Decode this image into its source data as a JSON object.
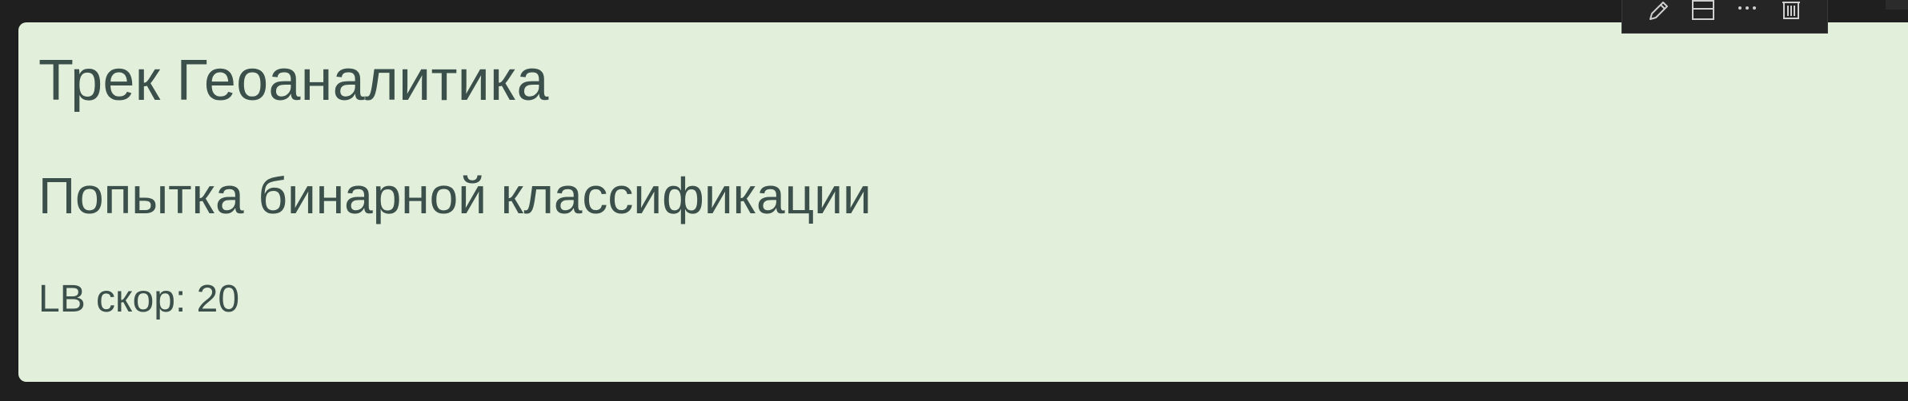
{
  "cell": {
    "heading1": "Трек Геоаналитика",
    "heading2": "Попытка бинарной классификации",
    "paragraph": "LB скор: 20"
  },
  "toolbar": {
    "icons": [
      "edit-icon",
      "split-cell-icon",
      "more-icon",
      "delete-icon"
    ]
  },
  "colors": {
    "page_background": "#1f1f1f",
    "cell_background": "#e2f0db",
    "text": "#3b4f4b",
    "toolbar_background": "#252525",
    "toolbar_icon": "#cfcfcf"
  }
}
